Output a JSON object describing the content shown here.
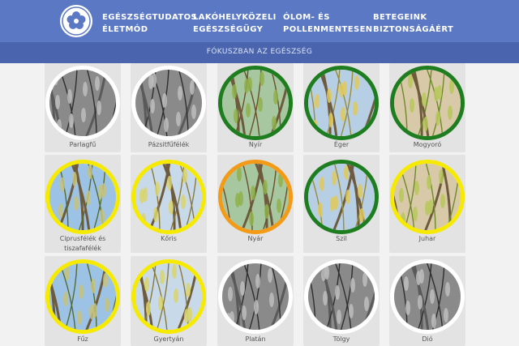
{
  "header": {
    "nav": [
      {
        "line1": "EGÉSZSÉGTUDATOS",
        "line2": "ÉLETMÓD"
      },
      {
        "line1": "LAKÓHELYKÖZELI",
        "line2": "EGÉSZSÉGÜGY"
      },
      {
        "line1": "ÓLOM- ÉS",
        "line2": "POLLENMENTESEN"
      },
      {
        "line1": "BETEGEINK",
        "line2": "BIZTONSÁGÁÉRT"
      }
    ]
  },
  "subheader": {
    "label": "FÓKUSZBAN AZ EGÉSZSÉG"
  },
  "ring_colors": {
    "none": "#ffffff",
    "green": "#1e7d1e",
    "yellow": "#f6ea00",
    "orange": "#f39a17"
  },
  "plants": [
    {
      "label": "Parlagfű",
      "ring": "none",
      "grayscale": true
    },
    {
      "label": "Pázsitfűfélék",
      "ring": "none",
      "grayscale": true
    },
    {
      "label": "Nyír",
      "ring": "green",
      "grayscale": false
    },
    {
      "label": "Éger",
      "ring": "green",
      "grayscale": false
    },
    {
      "label": "Mogyoró",
      "ring": "green",
      "grayscale": false
    },
    {
      "label": "Ciprusfélék és tiszafafélék",
      "ring": "yellow",
      "grayscale": false
    },
    {
      "label": "Kőris",
      "ring": "yellow",
      "grayscale": false
    },
    {
      "label": "Nyár",
      "ring": "orange",
      "grayscale": false
    },
    {
      "label": "Szil",
      "ring": "green",
      "grayscale": false
    },
    {
      "label": "Juhar",
      "ring": "yellow",
      "grayscale": false
    },
    {
      "label": "Fűz",
      "ring": "yellow",
      "grayscale": false
    },
    {
      "label": "Gyertyán",
      "ring": "yellow",
      "grayscale": false
    },
    {
      "label": "Platán",
      "ring": "none",
      "grayscale": true
    },
    {
      "label": "Tölgy",
      "ring": "none",
      "grayscale": true
    },
    {
      "label": "Dió",
      "ring": "none",
      "grayscale": true
    }
  ]
}
